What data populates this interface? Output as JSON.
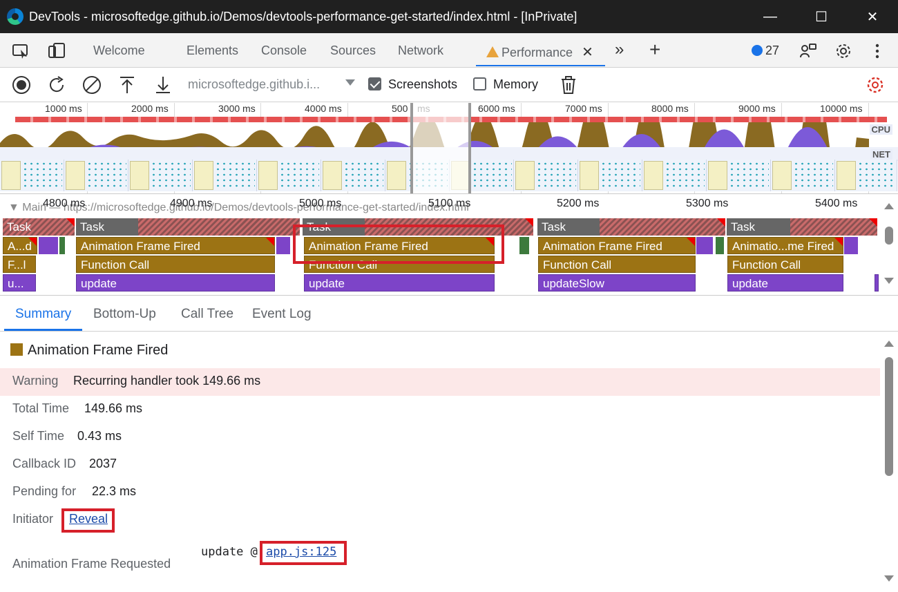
{
  "window": {
    "title": "DevTools - microsoftedge.github.io/Demos/devtools-performance-get-started/index.html - [InPrivate]",
    "minimize": "—",
    "maximize": "☐",
    "close": "✕"
  },
  "tabs": {
    "items": [
      "Welcome",
      "Elements",
      "Console",
      "Sources",
      "Network"
    ],
    "active": "Performance",
    "more": "»",
    "add": "+",
    "issues_count": "27"
  },
  "toolbar": {
    "url": "microsoftedge.github.i...",
    "screenshots_label": "Screenshots",
    "screenshots_checked": true,
    "memory_label": "Memory",
    "memory_checked": false
  },
  "overview": {
    "ticks": [
      "1000 ms",
      "2000 ms",
      "3000 ms",
      "4000 ms",
      "500",
      "ms",
      "6000 ms",
      "7000 ms",
      "8000 ms",
      "9000 ms",
      "10000 ms"
    ],
    "cpu_label": "CPU",
    "net_label": "NET"
  },
  "flame": {
    "main_label": "Main — https://microsoftedge.github.io/Demos/devtools-performance-get-started/index.html",
    "ticks": [
      "4800 ms",
      "4900 ms",
      "5000 ms",
      "5100 ms",
      "5200 ms",
      "5300 ms",
      "5400 ms"
    ],
    "task_label": "Task",
    "row2": [
      "A...d",
      "Animation Frame Fired",
      "Animation Frame Fired",
      "Animation Frame Fired",
      "Animatio...me Fired"
    ],
    "row3": [
      "F...l",
      "Function Call",
      "Function Call",
      "Function Call",
      "Function Call"
    ],
    "row4": [
      "u...",
      "update",
      "update",
      "updateSlow",
      "update"
    ]
  },
  "bottom_tabs": {
    "items": [
      "Summary",
      "Bottom-Up",
      "Call Tree",
      "Event Log"
    ]
  },
  "summary": {
    "title": "Animation Frame Fired",
    "warning_label": "Warning",
    "warning_value": "Recurring handler took 149.66 ms",
    "rows": [
      {
        "label": "Total Time",
        "value": "149.66 ms"
      },
      {
        "label": "Self Time",
        "value": "0.43 ms"
      },
      {
        "label": "Callback ID",
        "value": "2037"
      },
      {
        "label": "Pending for",
        "value": "22.3 ms"
      }
    ],
    "initiator_label": "Initiator",
    "initiator_link": "Reveal",
    "requested_label": "Animation Frame Requested",
    "requested_fn": "update @ ",
    "requested_link": "app.js:125"
  },
  "colors": {
    "accent": "#1a73e8",
    "animation_frame": "#9c7314",
    "update": "#7d44c8",
    "highlight": "#d6202a",
    "warning_bg": "#fce8e8"
  }
}
